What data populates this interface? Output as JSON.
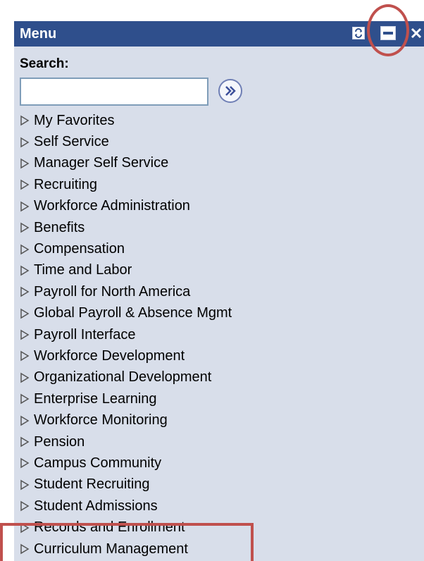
{
  "window": {
    "title": "Menu",
    "icons": [
      "refresh-icon",
      "minimize-icon",
      "close-icon"
    ]
  },
  "search": {
    "label": "Search:",
    "value": "",
    "placeholder": ""
  },
  "menu": {
    "items": [
      "My Favorites",
      "Self Service",
      "Manager Self Service",
      "Recruiting",
      "Workforce Administration",
      "Benefits",
      "Compensation",
      "Time and Labor",
      "Payroll for North America",
      "Global Payroll & Absence Mgmt",
      "Payroll Interface",
      "Workforce Development",
      "Organizational Development",
      "Enterprise Learning",
      "Workforce Monitoring",
      "Pension",
      "Campus Community",
      "Student Recruiting",
      "Student Admissions",
      "Records and Enrollment",
      "Curriculum Management"
    ]
  },
  "colors": {
    "titlebar": "#2f4f8c",
    "panel": "#d8deea",
    "highlight": "#c0504d"
  }
}
